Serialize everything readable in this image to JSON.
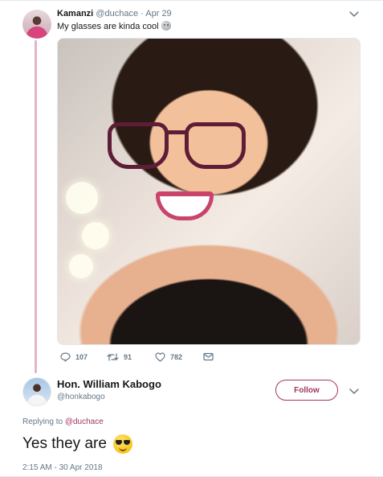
{
  "original_tweet": {
    "author_name": "Kamanzi",
    "author_handle": "@duchace",
    "separator": "·",
    "date": "Apr 29",
    "text": "My glasses are kinda cool",
    "text_emoji": "neutral-moon-face",
    "actions": {
      "replies": "107",
      "retweets": "91",
      "likes": "782"
    }
  },
  "reply_tweet": {
    "author_name": "Hon. William Kabogo",
    "author_handle": "@honkabogo",
    "follow_label": "Follow",
    "replying_prefix": "Replying to",
    "replying_to": "@duchace",
    "text": "Yes they are",
    "text_emoji": "smiling-face-with-sunglasses",
    "timestamp": "2:15 AM - 30 Apr 2018"
  },
  "colors": {
    "accent": "#a23663",
    "thread_line": "#e0b6c8",
    "secondary_text": "#657786",
    "primary_text": "#14171a"
  }
}
